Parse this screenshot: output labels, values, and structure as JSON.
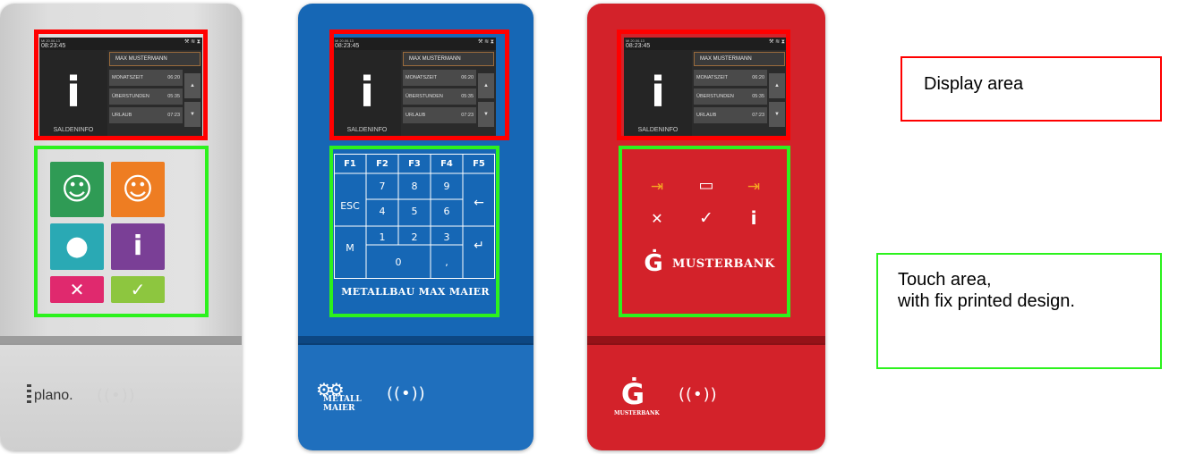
{
  "screen": {
    "date_small": "Mi 20.06.13",
    "time": "08:23:45",
    "icons": "⚒ ≋ ⧗",
    "info_icon": "i",
    "info_label": "SALDENINFO",
    "name": "MAX MUSTERMANN",
    "rows": [
      {
        "label": "MONATSZEIT",
        "value": "06:20"
      },
      {
        "label": "ÜBERSTUNDEN",
        "value": "05:35"
      },
      {
        "label": "URLAUB",
        "value": "07:23"
      }
    ],
    "arrow_up": "▲",
    "arrow_down": "▼"
  },
  "device1": {
    "buttons": {
      "smile": "☺",
      "thumb_smile": "☺",
      "foot": "●",
      "info": "i",
      "cancel": "✕",
      "ok": "✓"
    },
    "colors": {
      "green": "#2f9b55",
      "orange": "#ee7d22",
      "teal": "#2aa9b4",
      "purple": "#7a3f96",
      "pink": "#e0296e",
      "lime": "#8dc63f"
    },
    "brand": "plano.",
    "rfid": "((•))"
  },
  "device2": {
    "function_keys": [
      "F1",
      "F2",
      "F3",
      "F4",
      "F5"
    ],
    "esc": "ESC",
    "m": "M",
    "digits_row1": [
      "7",
      "8",
      "9"
    ],
    "digits_row2": [
      "4",
      "5",
      "6"
    ],
    "digits_row3": [
      "1",
      "2",
      "3"
    ],
    "zero": "0",
    "comma": ",",
    "backspace": "←",
    "enter": "↵",
    "company": "METALLBAU MAX MAIER",
    "logo_line1": "METALL",
    "logo_line2": "MAIER",
    "rfid": "((•))"
  },
  "device3": {
    "icon_login": "⇥",
    "icon_briefcase": "▭",
    "icon_logout": "⇥",
    "icon_cancel": "✕",
    "icon_ok": "✓",
    "icon_info": "i",
    "bank_logo": "Ġ",
    "bank_name": "MUSTERBANK",
    "bank_bottom_logo": "Ġ",
    "bank_bottom_name": "MUSTERBANK",
    "rfid": "((•))"
  },
  "labels": {
    "display_area": "Display area",
    "touch_line1": "Touch area,",
    "touch_line2": "with fix printed design."
  }
}
